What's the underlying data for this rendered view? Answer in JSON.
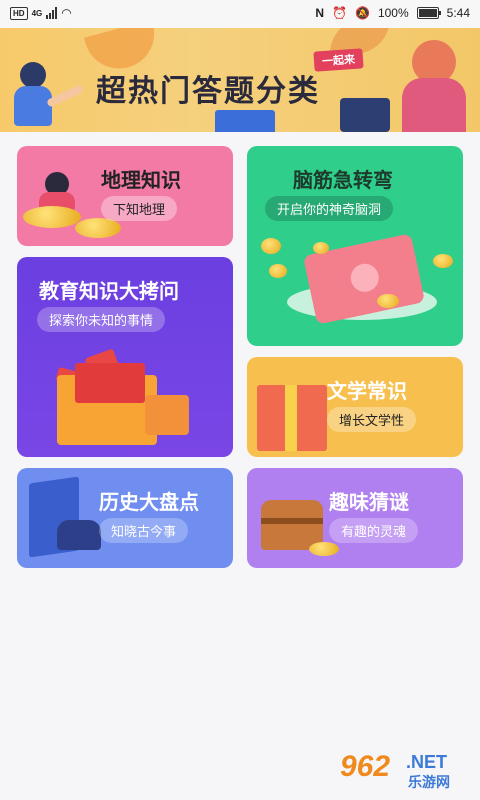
{
  "status_bar": {
    "hd": "HD",
    "signal": "4G",
    "battery": "100%",
    "time": "5:44"
  },
  "banner": {
    "title": "超热门答题分类",
    "tag": "一起来"
  },
  "categories": [
    {
      "title": "地理知识",
      "subtitle": "下知地理"
    },
    {
      "title": "脑筋急转弯",
      "subtitle": "开启你的神奇脑洞"
    },
    {
      "title": "教育知识大拷问",
      "subtitle": "探索你未知的事情"
    },
    {
      "title": "文学常识",
      "subtitle": "增长文学性"
    },
    {
      "title": "历史大盘点",
      "subtitle": "知晓古今事"
    },
    {
      "title": "趣味猜谜",
      "subtitle": "有趣的灵魂"
    }
  ],
  "watermark": {
    "number": "962",
    "domain": ".NET",
    "site": "乐游网"
  }
}
